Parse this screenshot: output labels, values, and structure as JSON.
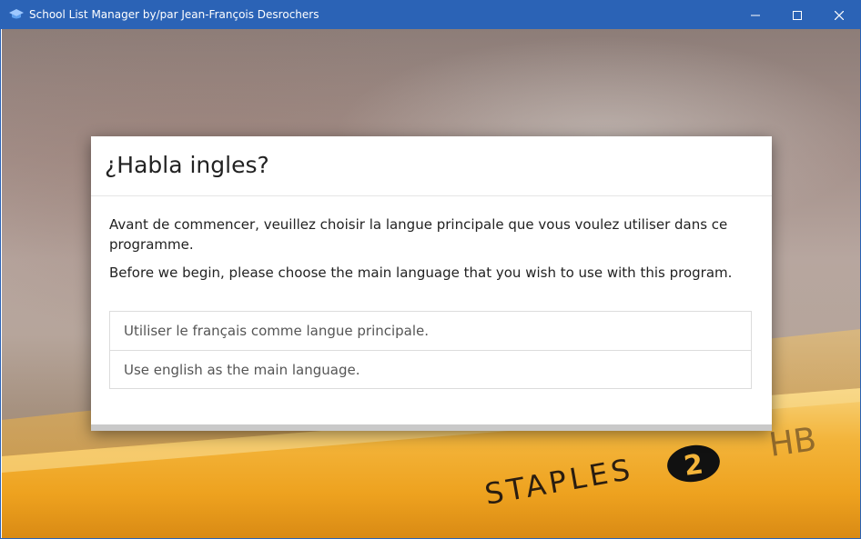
{
  "window": {
    "title": "School List Manager by/par Jean-François Desrochers",
    "controls": {
      "minimize_icon": "minimize-icon",
      "maximize_icon": "maximize-icon",
      "close_icon": "close-icon"
    }
  },
  "background": {
    "pencil_brand": "STAPLES",
    "pencil_number": "2",
    "pencil_grade": "HB"
  },
  "dialog": {
    "title": "¿Habla ingles?",
    "paragraph_fr": "Avant de commencer, veuillez choisir la langue principale que vous voulez utiliser dans ce programme.",
    "paragraph_en": "Before we begin, please choose the main language that you wish to use with this program.",
    "options": [
      {
        "label": "Utiliser le français comme langue principale."
      },
      {
        "label": "Use english as the main language."
      }
    ]
  },
  "colors": {
    "titlebar": "#2b63b6",
    "pencil_yellow": "#f2b63a"
  }
}
